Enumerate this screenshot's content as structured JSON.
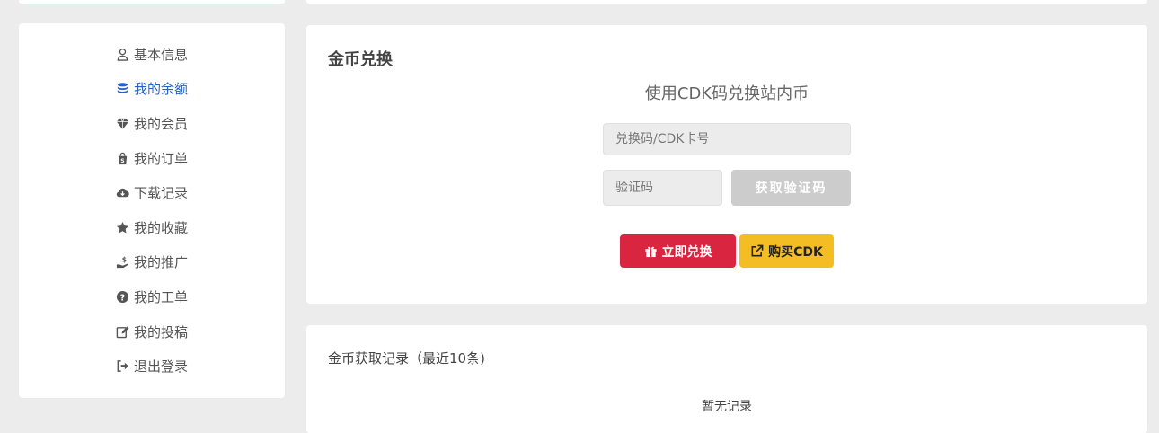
{
  "sidebar": {
    "items": [
      {
        "label": "基本信息",
        "icon": "user-icon",
        "active": false
      },
      {
        "label": "我的余额",
        "icon": "coins-icon",
        "active": true
      },
      {
        "label": "我的会员",
        "icon": "gem-icon",
        "active": false
      },
      {
        "label": "我的订单",
        "icon": "shopping-bag-icon",
        "active": false
      },
      {
        "label": "下载记录",
        "icon": "cloud-download-icon",
        "active": false
      },
      {
        "label": "我的收藏",
        "icon": "star-icon",
        "active": false
      },
      {
        "label": "我的推广",
        "icon": "hand-holding-dollar-icon",
        "active": false
      },
      {
        "label": "我的工单",
        "icon": "question-circle-icon",
        "active": false
      },
      {
        "label": "我的投稿",
        "icon": "edit-icon",
        "active": false
      },
      {
        "label": "退出登录",
        "icon": "sign-out-icon",
        "active": false
      }
    ]
  },
  "exchange": {
    "title": "金币兑换",
    "subtitle": "使用CDK码兑换站内币",
    "cdk_placeholder": "兑换码/CDK卡号",
    "code_placeholder": "验证码",
    "get_code_label": "获取验证码",
    "redeem_label": "立即兑换",
    "buy_label": "购买CDK"
  },
  "records": {
    "title": "金币获取记录（最近10条)",
    "empty_text": "暂无记录"
  },
  "colors": {
    "active": "#2563c9",
    "redeem": "#d9253f",
    "buy": "#f5bd24",
    "disabled": "#cccccc"
  }
}
